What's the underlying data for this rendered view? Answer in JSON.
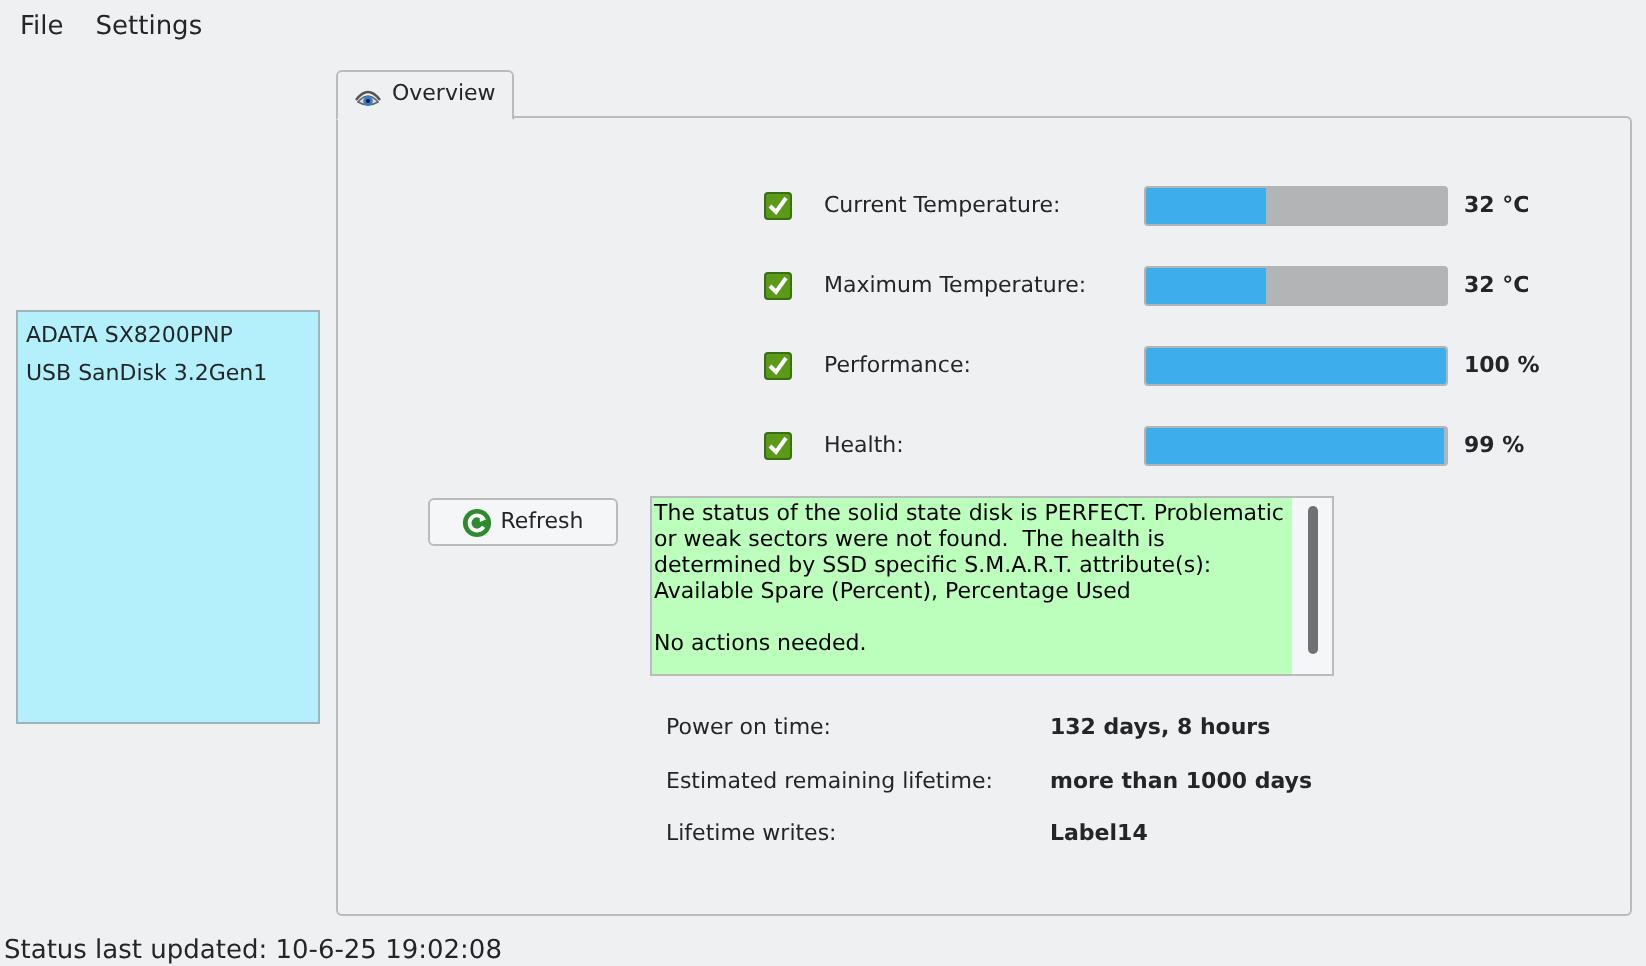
{
  "menu": [
    "File",
    "Settings"
  ],
  "devices": [
    {
      "label": "ADATA SX8200PNP"
    },
    {
      "label": "USB SanDisk 3.2Gen1"
    }
  ],
  "tabs": [
    {
      "label": "Overview",
      "selected": true
    }
  ],
  "metrics": [
    {
      "label": "Current Temperature:",
      "checked": true,
      "level": 0.4,
      "reading": "32 °C"
    },
    {
      "label": "Maximum Temperature:",
      "checked": true,
      "level": 0.4,
      "reading": "32 °C"
    },
    {
      "label": "Performance:",
      "checked": true,
      "level": 1.0,
      "reading": "100 %"
    },
    {
      "label": "Health:",
      "checked": true,
      "level": 0.99,
      "reading": "99 %"
    }
  ],
  "refresh_button": "Refresh",
  "status_message": {
    "paragraphs": [
      "The status of the solid state disk is PERFECT. Problematic or weak sectors were not found.  The health is determined by SSD specific S.M.A.R.T. attribute(s): Available Spare (Percent), Percentage Used",
      "No actions needed."
    ]
  },
  "details": [
    {
      "label": "Power on time:",
      "value": "132 days, 8 hours"
    },
    {
      "label": "Estimated remaining lifetime:",
      "value": "more than 1000 days"
    },
    {
      "label": "Lifetime writes:",
      "value": "Label14"
    }
  ],
  "status_bar": "Status last updated: 10-6-25 19:02:08"
}
